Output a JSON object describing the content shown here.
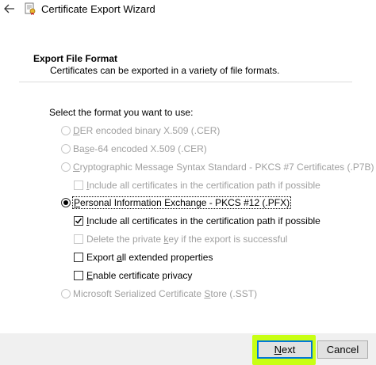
{
  "window": {
    "title": "Certificate Export Wizard",
    "back_icon": "back-arrow-icon",
    "app_icon": "certificate-icon"
  },
  "header": {
    "title": "Export File Format",
    "subtitle": "Certificates can be exported in a variety of file formats."
  },
  "prompt": "Select the format you want to use:",
  "formats": {
    "der": {
      "pre": "",
      "key": "D",
      "post": "ER encoded binary X.509 (.CER)",
      "selected": false,
      "enabled": false
    },
    "base64": {
      "pre": "Ba",
      "key": "s",
      "post": "e-64 encoded X.509 (.CER)",
      "selected": false,
      "enabled": false
    },
    "p7b": {
      "pre": "",
      "key": "C",
      "post": "ryptographic Message Syntax Standard - PKCS #7 Certificates (.P7B)",
      "selected": false,
      "enabled": false
    },
    "p7b_include": {
      "pre": "",
      "key": "I",
      "post": "nclude all certificates in the certification path if possible",
      "checked": false,
      "enabled": false
    },
    "pfx": {
      "pre": "",
      "key": "P",
      "post": "ersonal Information Exchange - PKCS #12 (.PFX)",
      "selected": true,
      "enabled": true
    },
    "pfx_include": {
      "pre": "",
      "key": "I",
      "post": "nclude all certificates in the certification path if possible",
      "checked": true,
      "enabled": true
    },
    "pfx_delete_key": {
      "pre": "Delete the private ",
      "key": "k",
      "post": "ey if the export is successful",
      "checked": false,
      "enabled": false
    },
    "pfx_extended": {
      "pre": "Export ",
      "key": "a",
      "post": "ll extended properties",
      "checked": false,
      "enabled": true
    },
    "pfx_privacy": {
      "pre": "",
      "key": "E",
      "post": "nable certificate privacy",
      "checked": false,
      "enabled": true
    },
    "sst": {
      "pre": "Microsoft Serialized Certificate ",
      "key": "S",
      "post": "tore (.SST)",
      "selected": false,
      "enabled": false
    }
  },
  "buttons": {
    "next": {
      "key": "N",
      "rest": "ext"
    },
    "cancel": "Cancel"
  },
  "colors": {
    "highlight": "#c8ff14",
    "focus_border": "#0078d7",
    "footer_bg": "#f0f0f0",
    "disabled_text": "#a0a0a0"
  }
}
